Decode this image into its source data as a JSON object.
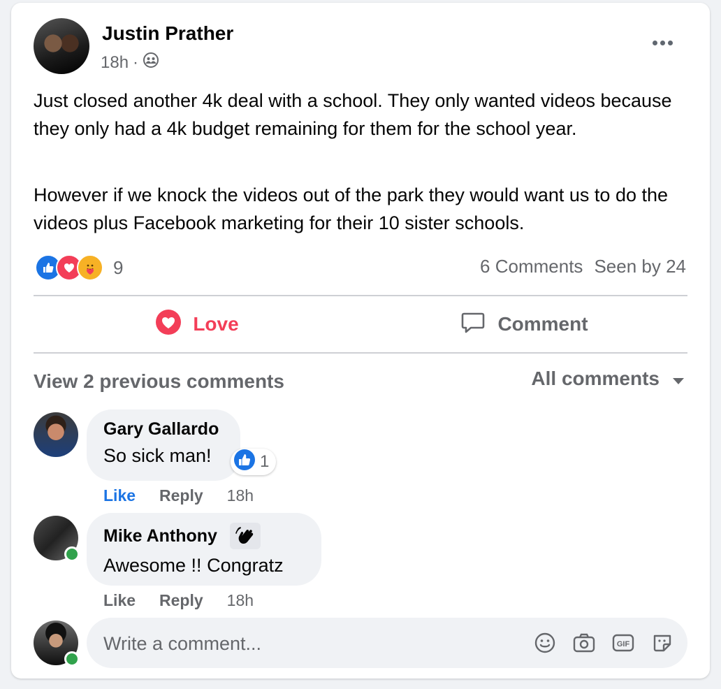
{
  "post": {
    "author": "Justin Prather",
    "time": "18h",
    "audience_icon": "friends-icon",
    "paragraphs": [
      "Just closed another 4k deal with a school. They only wanted videos because they only had a 4k budget remaining for them for the school year.",
      "However if we knock the videos out of the park they would want us to do the videos plus Facebook marketing for their 10 sister schools."
    ],
    "reactions": {
      "icons": [
        "like-icon",
        "love-icon",
        "care-icon"
      ],
      "count": "9"
    },
    "comments_count": "6 Comments",
    "seen_by": "Seen by 24"
  },
  "actions": {
    "love_label": "Love",
    "comment_label": "Comment"
  },
  "comments_section": {
    "view_previous": "View 2 previous comments",
    "filter": "All comments"
  },
  "comments": [
    {
      "name": "Gary Gallardo",
      "text": "So sick man!",
      "reaction_count": "1",
      "like_label": "Like",
      "reply_label": "Reply",
      "time": "18h"
    },
    {
      "name": "Mike Anthony",
      "badge": "wave-icon",
      "text": "Awesome !! Congratz",
      "like_label": "Like",
      "reply_label": "Reply",
      "time": "18h"
    }
  ],
  "composer": {
    "placeholder": "Write a comment...",
    "icons": [
      "emoji-icon",
      "camera-icon",
      "gif-icon",
      "sticker-icon"
    ]
  },
  "colors": {
    "love": "#f33e58",
    "like_blue": "#1b74e4",
    "secondary_text": "#65676b",
    "online": "#31a24c"
  }
}
